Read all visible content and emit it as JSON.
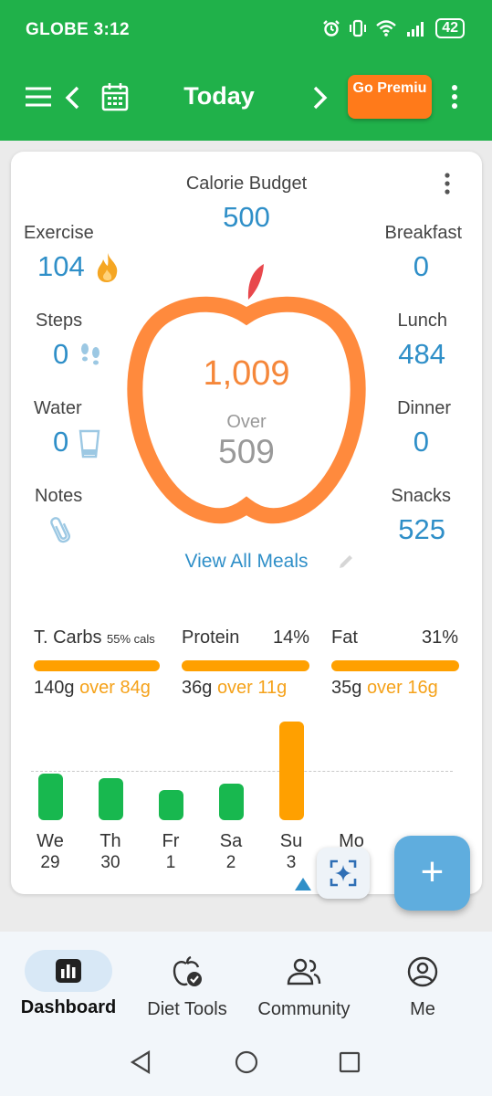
{
  "status_bar": {
    "carrier_time": "GLOBE 3:12",
    "battery": "42"
  },
  "app_bar": {
    "title": "Today",
    "premium_label": "Go Premiu"
  },
  "summary": {
    "calorie_budget_label": "Calorie Budget",
    "calorie_budget_value": "500",
    "left": [
      {
        "label": "Exercise",
        "value": "104",
        "icon": "flame-icon"
      },
      {
        "label": "Steps",
        "value": "0",
        "icon": "footsteps-icon"
      },
      {
        "label": "Water",
        "value": "0",
        "icon": "glass-icon"
      },
      {
        "label": "Notes",
        "value": "",
        "icon": "paperclip-icon"
      }
    ],
    "right": [
      {
        "label": "Breakfast",
        "value": "0"
      },
      {
        "label": "Lunch",
        "value": "484"
      },
      {
        "label": "Dinner",
        "value": "0"
      },
      {
        "label": "Snacks",
        "value": "525"
      }
    ],
    "consumed": "1,009",
    "over_label": "Over",
    "over_value": "509",
    "view_all_label": "View All Meals"
  },
  "macros": [
    {
      "title": "T. Carbs",
      "note": "55% cals",
      "pct": "",
      "grams": "140g",
      "over": "over 84g"
    },
    {
      "title": "Protein",
      "note": "",
      "pct": "14%",
      "grams": "36g",
      "over": "over 11g"
    },
    {
      "title": "Fat",
      "note": "",
      "pct": "31%",
      "grams": "35g",
      "over": "over 16g"
    }
  ],
  "week": [
    {
      "day": "We",
      "date": "29",
      "level": 0.47,
      "color": "#18b84f"
    },
    {
      "day": "Th",
      "date": "30",
      "level": 0.43,
      "color": "#18b84f"
    },
    {
      "day": "Fr",
      "date": "1",
      "level": 0.31,
      "color": "#18b84f"
    },
    {
      "day": "Sa",
      "date": "2",
      "level": 0.37,
      "color": "#18b84f"
    },
    {
      "day": "Su",
      "date": "3",
      "level": 1.0,
      "color": "#ffa000"
    },
    {
      "day": "Mo",
      "date": "",
      "level": 0,
      "color": "#18b84f"
    }
  ],
  "colors": {
    "brand_green": "#20b14a",
    "accent_orange": "#f5873a",
    "value_blue": "#2f8fc8",
    "fab_blue": "#5fadde"
  },
  "bottom_nav": [
    {
      "label": "Dashboard",
      "icon": "bar-chart-icon",
      "active": true
    },
    {
      "label": "Diet Tools",
      "icon": "apple-check-icon",
      "active": false
    },
    {
      "label": "Community",
      "icon": "people-icon",
      "active": false
    },
    {
      "label": "Me",
      "icon": "person-circle-icon",
      "active": false
    }
  ]
}
